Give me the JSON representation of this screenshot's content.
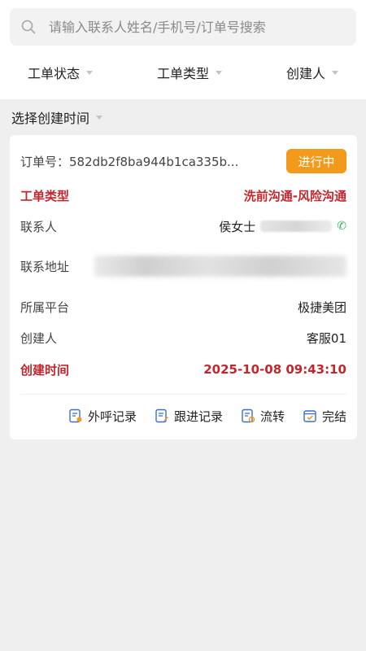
{
  "search": {
    "placeholder": "请输入联系人姓名/手机号/订单号搜索"
  },
  "filters": [
    {
      "label": "工单状态"
    },
    {
      "label": "工单类型"
    },
    {
      "label": "创建人"
    }
  ],
  "time_filter": {
    "label": "选择创建时间"
  },
  "order": {
    "order_no": "订单号：582db2f8ba944b1ca335b...",
    "status": "进行中",
    "status_color": "#f39a1c",
    "type_label": "工单类型",
    "type_value": "洗前沟通-风险沟通",
    "contact_label": "联系人",
    "contact_value": "侯女士",
    "address_label": "联系地址",
    "platform_label": "所属平台",
    "platform_value": "极捷美团",
    "creator_label": "创建人",
    "creator_value": "客服01",
    "created_label": "创建时间",
    "created_value": "2025-10-08 09:43:10",
    "accent_red": "#c1272d"
  },
  "actions": [
    {
      "label": "外呼记录",
      "icon": "call-record-icon"
    },
    {
      "label": "跟进记录",
      "icon": "follow-up-icon"
    },
    {
      "label": "流转",
      "icon": "transfer-icon"
    },
    {
      "label": "完结",
      "icon": "complete-icon"
    }
  ]
}
